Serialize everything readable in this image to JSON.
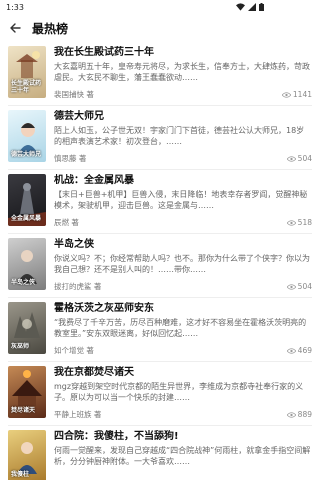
{
  "status": {
    "time": "1:33"
  },
  "header": {
    "title": "最热榜"
  },
  "books": [
    {
      "title": "我在长生殿试药三十年",
      "desc": "大玄嘉明五十年，皇帝寿元将尽，为求长生，信奉方士，大肆炼药，苛政虐民。大玄民不聊生，藩王蠢蠢欲动……",
      "author": "裴国捕快 著",
      "views": "1141",
      "cover_text": "长生殿试药三十年",
      "cover_bg": "#d7c6a4"
    },
    {
      "title": "德芸大师兄",
      "desc": "陌上人如玉，公子世无双！宇家门门下首徒，德芸社公认大师兄，18岁的相声表演艺术家！初次登台，……",
      "author": "慎思藤 著",
      "views": "504",
      "cover_text": "德芸大师兄",
      "cover_bg": "#bfe0ee"
    },
    {
      "title": "机战：全金属风暴",
      "desc": "【末日+巨兽+机甲】巨兽入侵，末日降临！地表幸存者罗阎，觉醒神秘模术，架驶机甲，迎击巨兽。这是金属与……",
      "author": "辰燃 著",
      "views": "518",
      "cover_text": "全金属风暴",
      "cover_bg": "#2b2b2f"
    },
    {
      "title": "半岛之侠",
      "desc": "你说义吗？不；你经常帮助人吗？也不。那你为什么带了个侠字？你以为我自己想？还不是别人叫的！……带你……",
      "author": "拔打的虎鲨 著",
      "views": "504",
      "cover_text": "半岛之侠",
      "cover_bg": "#9a9a9a"
    },
    {
      "title": "霍格沃茨之灰巫师安东",
      "desc": "“我费尽了千辛万苦，历尽百种磨难，这才好不容易坐在霍格沃茨明亮的教室里。”安东双眼迷离，好似回忆起……",
      "author": "如个增觉 著",
      "views": "469",
      "cover_text": "灰巫师",
      "cover_bg": "#6d6b60"
    },
    {
      "title": "我在京都焚尽诸天",
      "desc": "mgz穿越到架空时代京都的陌生异世界，李维成为京都寺社奉行家的义子。原以为可以当一个快乐的封建……",
      "author": "平静上班族 著",
      "views": "889",
      "cover_text": "焚尽诸天",
      "cover_bg": "#8a4a2a"
    },
    {
      "title": "四合院：我傻柱，不当舔狗!",
      "desc": "何雨一觉醒来，发现自己穿越成“四合院战神”何雨柱，就拿金手指空间解析，分分钟厨神附体。一大爷喜欢……",
      "author": "",
      "views": "",
      "cover_text": "我傻柱",
      "cover_bg": "#c9a24a"
    }
  ]
}
